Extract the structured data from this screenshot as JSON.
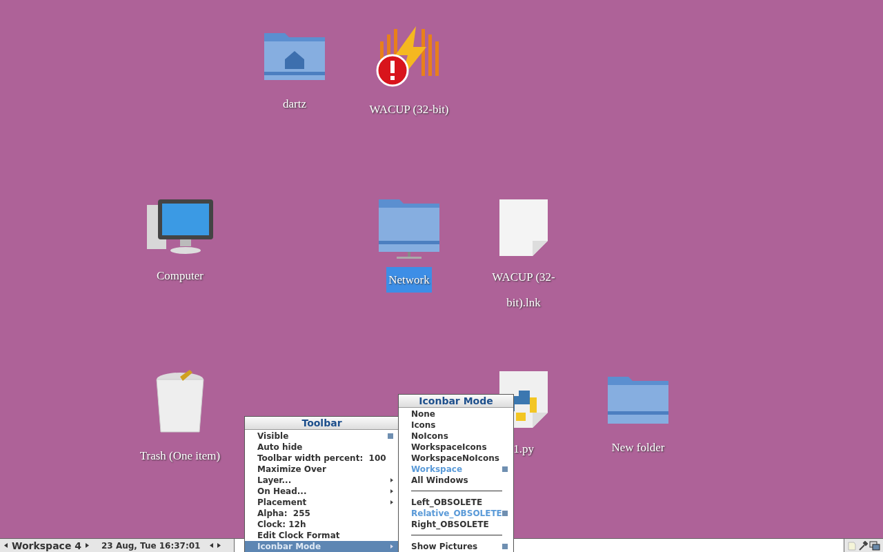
{
  "desktop": {
    "icons": [
      {
        "label": "dartz",
        "kind": "home-folder",
        "selected": false
      },
      {
        "label": "WACUP (32-bit)",
        "kind": "app",
        "selected": false
      },
      {
        "label": "Computer",
        "kind": "computer",
        "selected": false
      },
      {
        "label": "Network",
        "kind": "network",
        "selected": true
      },
      {
        "label": "WACUP (32-bit).lnk",
        "kind": "unknown-file",
        "selected": false
      },
      {
        "label": "Trash (One item)",
        "kind": "trash",
        "selected": false
      },
      {
        "label": "1.py",
        "kind": "python",
        "selected": false
      },
      {
        "label": "New folder",
        "kind": "folder",
        "selected": false
      }
    ]
  },
  "toolbar_menu": {
    "title": "Toolbar",
    "items": [
      {
        "label": "Visible",
        "kind": "toggle",
        "checked": true,
        "selected": false
      },
      {
        "label": "Auto hide",
        "kind": "toggle",
        "checked": false,
        "selected": false
      },
      {
        "label": "Toolbar width percent:  100",
        "kind": "plain",
        "selected": false
      },
      {
        "label": "Maximize Over",
        "kind": "toggle",
        "checked": false,
        "selected": false
      },
      {
        "label": "Layer...",
        "kind": "submenu",
        "selected": false
      },
      {
        "label": "On Head...",
        "kind": "submenu",
        "selected": false
      },
      {
        "label": "Placement",
        "kind": "submenu",
        "selected": false
      },
      {
        "label": "Alpha:  255",
        "kind": "plain",
        "selected": false
      },
      {
        "label": "Clock: 12h",
        "kind": "plain",
        "selected": false
      },
      {
        "label": "Edit Clock Format",
        "kind": "plain",
        "selected": false
      },
      {
        "label": "Iconbar Mode",
        "kind": "submenu",
        "selected": true
      }
    ]
  },
  "iconbar_menu": {
    "title": "Iconbar Mode",
    "items": [
      {
        "label": "None",
        "kind": "radio",
        "selected": false
      },
      {
        "label": "Icons",
        "kind": "radio",
        "selected": false
      },
      {
        "label": "NoIcons",
        "kind": "radio",
        "selected": false
      },
      {
        "label": "WorkspaceIcons",
        "kind": "radio",
        "selected": false
      },
      {
        "label": "WorkspaceNoIcons",
        "kind": "radio",
        "selected": false
      },
      {
        "label": "Workspace",
        "kind": "radio",
        "selected": true
      },
      {
        "label": "All Windows",
        "kind": "radio",
        "selected": false
      },
      {
        "kind": "separator"
      },
      {
        "label": "Left_OBSOLETE",
        "kind": "radio",
        "selected": false
      },
      {
        "label": "Relative_OBSOLETE",
        "kind": "radio",
        "selected": true
      },
      {
        "label": "Right_OBSOLETE",
        "kind": "radio",
        "selected": false
      },
      {
        "kind": "separator"
      },
      {
        "label": "Show Pictures",
        "kind": "toggle",
        "checked": true
      }
    ]
  },
  "taskbar": {
    "workspace": "Workspace 4",
    "clock": "23 Aug, Tue 16:37:01"
  }
}
